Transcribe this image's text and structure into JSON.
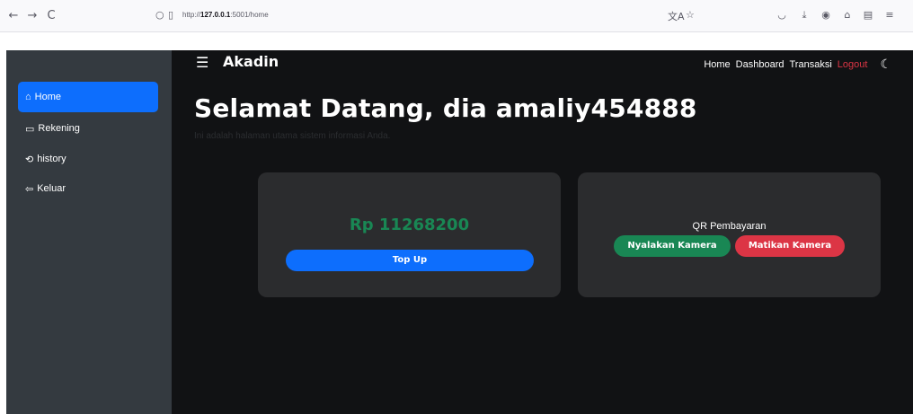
{
  "browser": {
    "back": "←",
    "forward": "→",
    "reload": "C",
    "url_prefix": "http://",
    "url_host": "127.0.0.1",
    "url_path": ":5001/home"
  },
  "navbar": {
    "brand": "Akadin",
    "links": [
      "Home",
      "Dashboard",
      "Transaksi"
    ],
    "logout": "Logout"
  },
  "sidebar": {
    "items": [
      {
        "icon": "⌂",
        "label": "Home",
        "active": true
      },
      {
        "icon": "▭",
        "label": "Rekening"
      },
      {
        "icon": "⟲",
        "label": "history"
      },
      {
        "icon": "⇦",
        "label": "Keluar"
      }
    ]
  },
  "main": {
    "title": "Selamat Datang, dia amaliy454888",
    "subtitle": "Ini adalah halaman utama sistem informasi Anda."
  },
  "balance_card": {
    "balance": "Rp 11268200",
    "topup_label": "Top Up"
  },
  "qr_card": {
    "qr_label": "QR Pembayaran",
    "camera_on_label": "Nyalakan Kamera",
    "camera_off_label": "Matikan Kamera"
  },
  "colors": {
    "primary": "#0d6efd",
    "success": "#198754",
    "danger": "#dc3545",
    "sidebar": "#343a40",
    "background": "#111214"
  }
}
